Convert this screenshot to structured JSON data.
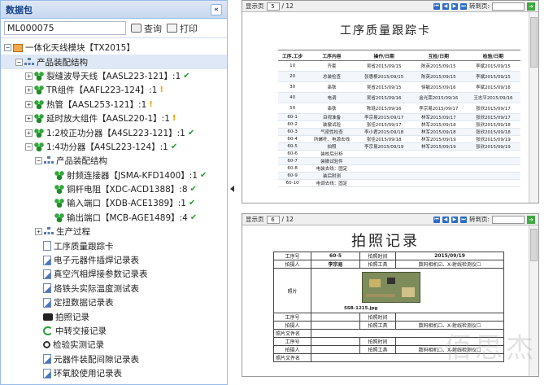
{
  "left_panel": {
    "title": "数据包",
    "collapse_glyph": "«",
    "search_value": "ML000075",
    "query_label": "查询",
    "print_label": "打印"
  },
  "tree": {
    "root": "一体化天线模块【TX2015】",
    "structure": "产品装配结构",
    "components": [
      {
        "label": "裂缝波导天线【AASL223-121】:1",
        "status": "ok"
      },
      {
        "label": "TR组件【AAFL223-124】:1",
        "status": "warn"
      },
      {
        "label": "热管【AASL253-121】:1",
        "status": "warn"
      },
      {
        "label": "延时放大组件【AASL220-1】:1",
        "status": "warn"
      },
      {
        "label": "1:2校正功分器【A4SL223-121】:1",
        "status": "ok"
      },
      {
        "label": "1:4功分器【A4SL223-124】:1",
        "status": "ok"
      }
    ],
    "sub_structure": "产品装配结构",
    "sub_parts": [
      {
        "label": "射频连接器【JSMA-KFD1400】:1",
        "status": "ok"
      },
      {
        "label": "铜杆电阻【XDC-ACD1388】:8",
        "status": "ok"
      },
      {
        "label": "输入端口【XDB-ACE1389】:1",
        "status": "ok"
      },
      {
        "label": "输出端口【MCB-AGE1489】:4",
        "status": "ok"
      }
    ],
    "process": "生产过程",
    "docs": [
      {
        "label": "工序质量跟踪卡",
        "icon": "doc"
      },
      {
        "label": "电子元器件插焊记录表",
        "icon": "doc-edit"
      },
      {
        "label": "真空汽相焊接参数记录表",
        "icon": "doc-edit"
      },
      {
        "label": "烙铁头实际温度测试表",
        "icon": "doc-edit"
      },
      {
        "label": "定扭数据记录表",
        "icon": "doc-edit"
      },
      {
        "label": "拍照记录",
        "icon": "camera"
      },
      {
        "label": "中转交接记录",
        "icon": "recycle"
      },
      {
        "label": "检验实测记录",
        "icon": "magnifier"
      },
      {
        "label": "元器件装配间隙记录表",
        "icon": "doc-edit"
      },
      {
        "label": "环氧胶使用记录表",
        "icon": "doc-edit"
      }
    ]
  },
  "viewer1": {
    "page_label": "显示页",
    "page_num": "5",
    "page_total": "/ 12",
    "goto_label": "转到页:",
    "title": "工序质量跟踪卡",
    "headers": [
      "工序.工步",
      "工序内容",
      "操作/日期",
      "互检/日期",
      "检验/日期"
    ],
    "rows": [
      [
        "10",
        "齐套",
        "吴省2015/09/15",
        "陈英2015/09/15",
        "李斌2015/09/15"
      ],
      [
        "20",
        "总装检查",
        "张惠根2015/09/15",
        "陈英2015/09/15",
        "李斌2015/09/15"
      ],
      [
        "30",
        "串铁",
        "吴省2015/09/15",
        "徐敏2015/09/16",
        "李斌2015/09/16"
      ],
      [
        "40",
        "电调",
        "吴省2015/09/16",
        "金光荣2015/09/16",
        "王志平2015/09/16"
      ],
      [
        "50",
        "串铁",
        "陈琏2015/09/16",
        "李宗易2015/09/17",
        "张欣2015/09/17"
      ],
      [
        "60-1",
        "目视准备",
        "李宗易2015/09/17",
        "林军2015/09/17",
        "张欣2015/09/17"
      ],
      [
        "60-2",
        "装撤试验",
        "张佳2015/09/17",
        "林军2015/09/18",
        "张欣2015/09/18"
      ],
      [
        "60-3",
        "气密性检查",
        "李小君2015/09/18",
        "林军2015/09/18",
        "张欣2015/09/18"
      ],
      [
        "60-4",
        "所螺杆、电源去线",
        "张佳2015/09/18",
        "林军2015/09/19",
        "张欣2015/09/19"
      ],
      [
        "60-5",
        "拍照",
        "李宗易2015/09/19",
        "林军2015/09/19",
        "张欣2015/09/19"
      ],
      [
        "60-6",
        "装校后分析",
        "",
        "",
        ""
      ],
      [
        "60-7",
        "装撤试验件",
        "",
        "",
        ""
      ],
      [
        "60-8",
        "电装去线：固定",
        "",
        "",
        ""
      ],
      [
        "60-9",
        "装后附测",
        "",
        "",
        ""
      ],
      [
        "60-10",
        "电调去线：固定",
        "",
        "",
        ""
      ]
    ]
  },
  "viewer2": {
    "page_label": "显示页",
    "page_num": "6",
    "page_total": "/ 12",
    "goto_label": "转到页:",
    "title": "拍照记录",
    "r1": [
      "工序号",
      "60-5",
      "拍照时间",
      "2015/09/19"
    ],
    "r2": [
      "拍摄人",
      "李宗易",
      "拍照工具",
      "数码相机☑、X-射线检测仪☐"
    ],
    "photo_label": "照片",
    "photo_caption": "SSB-1215.jpg",
    "r4": [
      "工序号",
      "",
      "拍照时间",
      ""
    ],
    "r5": [
      "拍摄人",
      "",
      "拍照工具",
      "数码相机☐、X-射线检测仪☐"
    ],
    "r6": [
      "照片文件名",
      "",
      "",
      ""
    ],
    "r7": [
      "工序号",
      "",
      "拍照时间",
      ""
    ],
    "r8": [
      "拍摄人",
      "",
      "拍照工具",
      "数码相机☐、X-射线检测仪☐"
    ],
    "r9": [
      "照片文件名",
      "",
      "",
      ""
    ]
  },
  "watermark": "佰思杰"
}
